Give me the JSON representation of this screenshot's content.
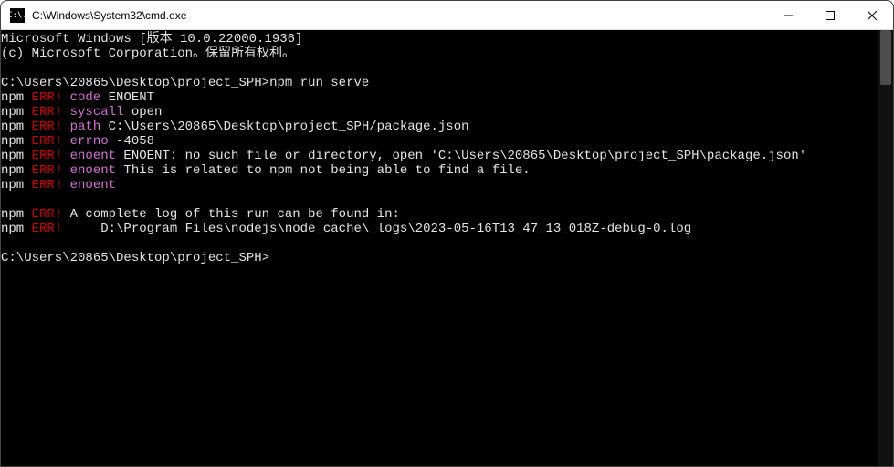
{
  "titlebar": {
    "icon_label": "C:\\.",
    "title": "C:\\Windows\\System32\\cmd.exe"
  },
  "terminal": {
    "banner1": "Microsoft Windows [版本 10.0.22000.1936]",
    "banner2": "(c) Microsoft Corporation。保留所有权利。",
    "prompt1_path": "C:\\Users\\20865\\Desktop\\project_SPH>",
    "prompt1_cmd": "npm run serve",
    "npm_prefix": "npm ",
    "err_label": "ERR!",
    "code_label": " code",
    "code_value": " ENOENT",
    "syscall_label": " syscall",
    "syscall_value": " open",
    "path_label": " path",
    "path_value": " C:\\Users\\20865\\Desktop\\project_SPH/package.json",
    "errno_label": " errno",
    "errno_value": " -4058",
    "enoent_label": " enoent",
    "enoent_msg1": " ENOENT: no such file or directory, open 'C:\\Users\\20865\\Desktop\\project_SPH\\package.json'",
    "enoent_msg2": " This is related to npm not being able to find a file.",
    "log_msg": " A complete log of this run can be found in:",
    "log_path": "     D:\\Program Files\\nodejs\\node_cache\\_logs\\2023-05-16T13_47_13_018Z-debug-0.log",
    "prompt2": "C:\\Users\\20865\\Desktop\\project_SPH>"
  }
}
